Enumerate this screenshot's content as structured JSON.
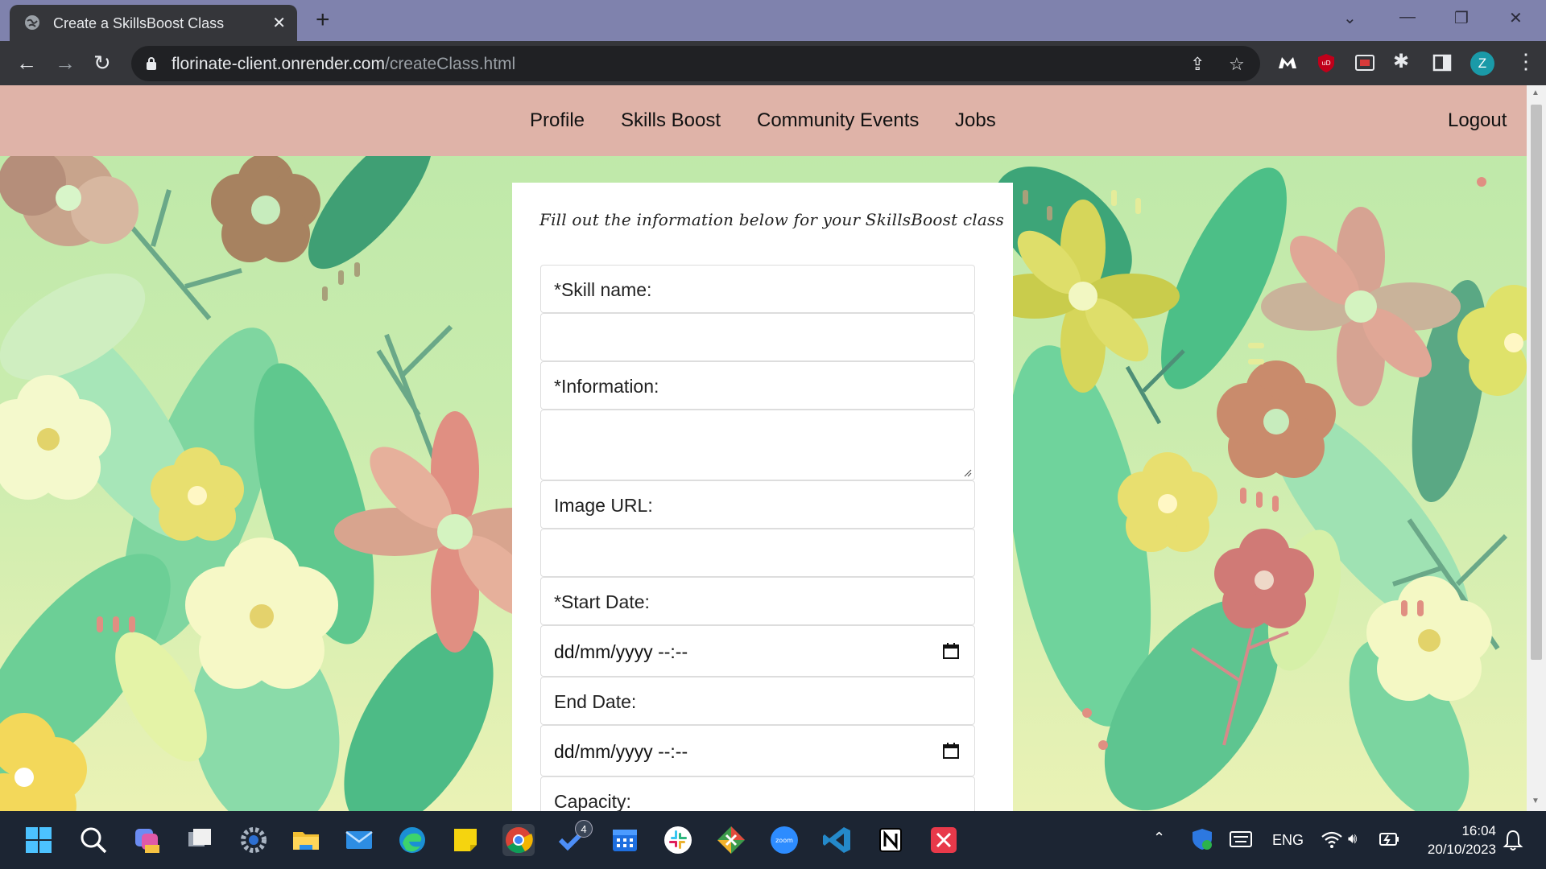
{
  "browser": {
    "tab_title": "Create a SkillsBoost Class",
    "new_tab_label": "+",
    "url_host": "florinate-client.onrender.com",
    "url_path": "/createClass.html",
    "profile_initial": "Z"
  },
  "nav": {
    "links": [
      "Profile",
      "Skills Boost",
      "Community Events",
      "Jobs"
    ],
    "logout": "Logout"
  },
  "form": {
    "heading": "Fill out the information below for your SkillsBoost class",
    "skill_label": "*Skill name:",
    "skill_value": "",
    "info_label": "*Information:",
    "info_value": "",
    "image_label": "Image URL:",
    "image_value": "",
    "start_label": "*Start Date:",
    "start_value": "dd/mm/yyyy  --:--",
    "end_label": "End Date:",
    "end_value": "dd/mm/yyyy  --:--",
    "capacity_label": "Capacity:"
  },
  "taskbar": {
    "badge_count": "4",
    "lang": "ENG",
    "time": "16:04",
    "date": "20/10/2023"
  },
  "colors": {
    "nav_bg": "#dfb3a8",
    "taskbar_bg": "#1c2533",
    "tabbar_bg": "#7f82ad"
  }
}
